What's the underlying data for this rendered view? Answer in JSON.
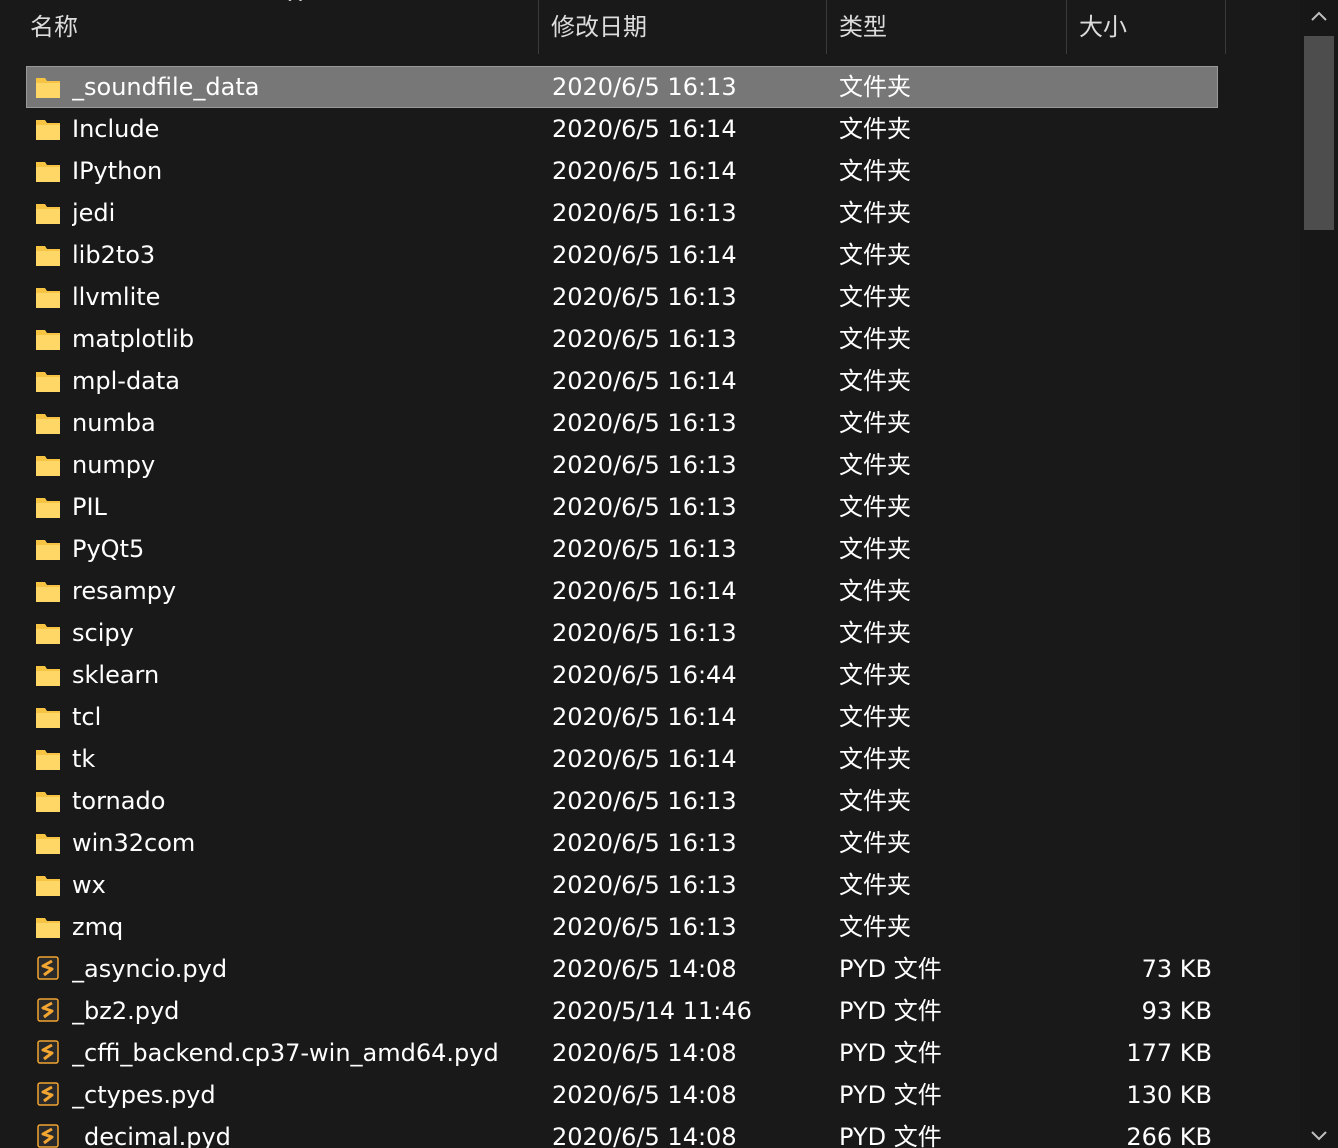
{
  "columns": {
    "name": "名称",
    "modified": "修改日期",
    "type": "类型",
    "size": "大小"
  },
  "sort_indicator": "^",
  "colors": {
    "background": "#191919",
    "selection": "#777777",
    "folder": "#f6c342",
    "pyd_icon": "#f2a531"
  },
  "rows": [
    {
      "icon": "folder-icon",
      "name": "_soundfile_data",
      "date": "2020/6/5 16:13",
      "type": "文件夹",
      "size": "",
      "selected": true
    },
    {
      "icon": "folder-icon",
      "name": "Include",
      "date": "2020/6/5 16:14",
      "type": "文件夹",
      "size": ""
    },
    {
      "icon": "folder-icon",
      "name": "IPython",
      "date": "2020/6/5 16:14",
      "type": "文件夹",
      "size": ""
    },
    {
      "icon": "folder-icon",
      "name": "jedi",
      "date": "2020/6/5 16:13",
      "type": "文件夹",
      "size": ""
    },
    {
      "icon": "folder-icon",
      "name": "lib2to3",
      "date": "2020/6/5 16:14",
      "type": "文件夹",
      "size": ""
    },
    {
      "icon": "folder-icon",
      "name": "llvmlite",
      "date": "2020/6/5 16:13",
      "type": "文件夹",
      "size": ""
    },
    {
      "icon": "folder-icon",
      "name": "matplotlib",
      "date": "2020/6/5 16:13",
      "type": "文件夹",
      "size": ""
    },
    {
      "icon": "folder-icon",
      "name": "mpl-data",
      "date": "2020/6/5 16:14",
      "type": "文件夹",
      "size": ""
    },
    {
      "icon": "folder-icon",
      "name": "numba",
      "date": "2020/6/5 16:13",
      "type": "文件夹",
      "size": ""
    },
    {
      "icon": "folder-icon",
      "name": "numpy",
      "date": "2020/6/5 16:13",
      "type": "文件夹",
      "size": ""
    },
    {
      "icon": "folder-icon",
      "name": "PIL",
      "date": "2020/6/5 16:13",
      "type": "文件夹",
      "size": ""
    },
    {
      "icon": "folder-icon",
      "name": "PyQt5",
      "date": "2020/6/5 16:13",
      "type": "文件夹",
      "size": ""
    },
    {
      "icon": "folder-icon",
      "name": "resampy",
      "date": "2020/6/5 16:14",
      "type": "文件夹",
      "size": ""
    },
    {
      "icon": "folder-icon",
      "name": "scipy",
      "date": "2020/6/5 16:13",
      "type": "文件夹",
      "size": ""
    },
    {
      "icon": "folder-icon",
      "name": "sklearn",
      "date": "2020/6/5 16:44",
      "type": "文件夹",
      "size": ""
    },
    {
      "icon": "folder-icon",
      "name": "tcl",
      "date": "2020/6/5 16:14",
      "type": "文件夹",
      "size": ""
    },
    {
      "icon": "folder-icon",
      "name": "tk",
      "date": "2020/6/5 16:14",
      "type": "文件夹",
      "size": ""
    },
    {
      "icon": "folder-icon",
      "name": "tornado",
      "date": "2020/6/5 16:13",
      "type": "文件夹",
      "size": ""
    },
    {
      "icon": "folder-icon",
      "name": "win32com",
      "date": "2020/6/5 16:13",
      "type": "文件夹",
      "size": ""
    },
    {
      "icon": "folder-icon",
      "name": "wx",
      "date": "2020/6/5 16:13",
      "type": "文件夹",
      "size": ""
    },
    {
      "icon": "folder-icon",
      "name": "zmq",
      "date": "2020/6/5 16:13",
      "type": "文件夹",
      "size": ""
    },
    {
      "icon": "pyd-file-icon",
      "name": "_asyncio.pyd",
      "date": "2020/6/5 14:08",
      "type": "PYD 文件",
      "size": "73 KB"
    },
    {
      "icon": "pyd-file-icon",
      "name": "_bz2.pyd",
      "date": "2020/5/14 11:46",
      "type": "PYD 文件",
      "size": "93 KB"
    },
    {
      "icon": "pyd-file-icon",
      "name": "_cffi_backend.cp37-win_amd64.pyd",
      "date": "2020/6/5 14:08",
      "type": "PYD 文件",
      "size": "177 KB"
    },
    {
      "icon": "pyd-file-icon",
      "name": "_ctypes.pyd",
      "date": "2020/6/5 14:08",
      "type": "PYD 文件",
      "size": "130 KB"
    },
    {
      "icon": "pyd-file-icon",
      "name": "_decimal.pyd",
      "date": "2020/6/5 14:08",
      "type": "PYD 文件",
      "size": "266 KB"
    }
  ]
}
